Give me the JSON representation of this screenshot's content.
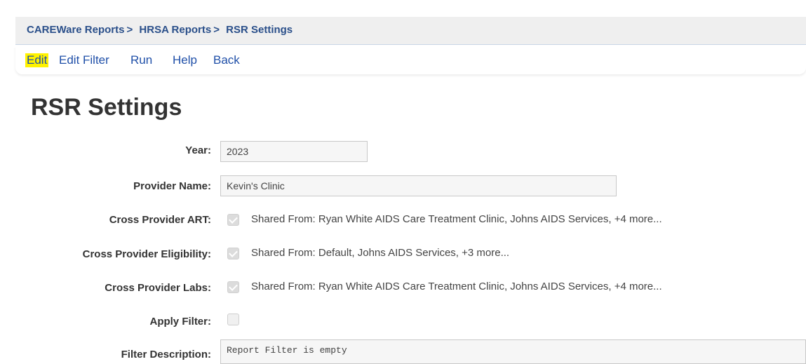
{
  "breadcrumb": {
    "items": [
      "CAREWare Reports",
      "HRSA Reports",
      "RSR Settings"
    ],
    "separator": ">"
  },
  "menu": {
    "items": [
      "Edit",
      "Edit Filter",
      "Run",
      "Help",
      "Back"
    ],
    "highlighted": "Edit"
  },
  "page_title": "RSR Settings",
  "form": {
    "year": {
      "label": "Year:",
      "value": "2023"
    },
    "provider_name": {
      "label": "Provider Name:",
      "value": "Kevin's Clinic"
    },
    "cross_provider_art": {
      "label": "Cross Provider ART:",
      "checked": true,
      "text": "Shared From: Ryan White AIDS Care Treatment Clinic, Johns AIDS Services, +4 more..."
    },
    "cross_provider_eligibility": {
      "label": "Cross Provider Eligibility:",
      "checked": true,
      "text": "Shared From: Default, Johns AIDS Services, +3 more..."
    },
    "cross_provider_labs": {
      "label": "Cross Provider Labs:",
      "checked": true,
      "text": "Shared From: Ryan White AIDS Care Treatment Clinic, Johns AIDS Services, +4 more..."
    },
    "apply_filter": {
      "label": "Apply Filter:",
      "checked": false
    },
    "filter_description": {
      "label": "Filter Description:",
      "value": "Report Filter is empty"
    }
  },
  "colors": {
    "link": "#1f4fa8",
    "breadcrumb": "#2a4f8a",
    "highlight": "#fff200"
  }
}
